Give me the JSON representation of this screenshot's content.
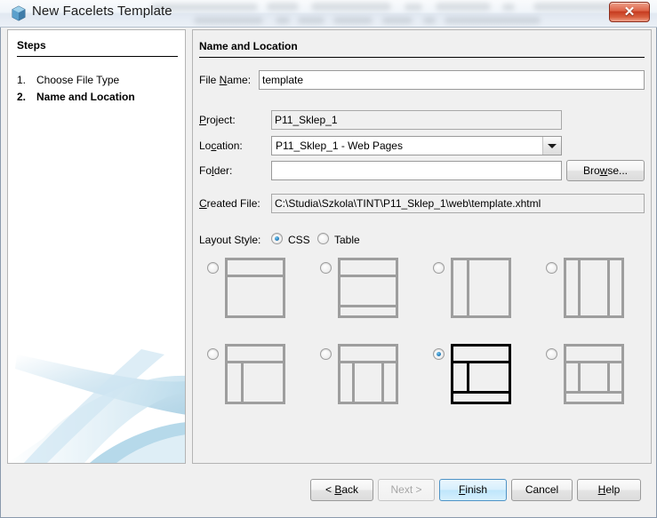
{
  "window": {
    "title": "New Facelets Template",
    "icon": "cube-icon",
    "close_label": "✕"
  },
  "steps": {
    "heading": "Steps",
    "items": [
      {
        "number": "1.",
        "label": "Choose File Type",
        "current": false
      },
      {
        "number": "2.",
        "label": "Name and Location",
        "current": true
      }
    ]
  },
  "content": {
    "heading": "Name and Location",
    "fields": {
      "file_name": {
        "label_pre": "File ",
        "mnemonic": "N",
        "label_post": "ame:",
        "value": "template",
        "placeholder": ""
      },
      "project": {
        "mnemonic": "P",
        "label_post": "roject:",
        "label_pre": "",
        "value": "P11_Sklep_1"
      },
      "location": {
        "label_pre": "Lo",
        "mnemonic": "c",
        "label_post": "ation:",
        "value": "P11_Sklep_1 - Web Pages",
        "options": [
          "P11_Sklep_1 - Web Pages"
        ]
      },
      "folder": {
        "label_pre": "Fo",
        "mnemonic": "l",
        "label_post": "der:",
        "value": "",
        "placeholder": ""
      },
      "created_file": {
        "label_pre": "",
        "mnemonic": "C",
        "label_post": "reated File:",
        "value": "C:\\Studia\\Szkola\\TINT\\P11_Sklep_1\\web\\template.xhtml"
      }
    },
    "browse_button": {
      "label_pre": "Bro",
      "mnemonic": "w",
      "label_post": "se..."
    },
    "layout_style": {
      "label": "Layout Style:",
      "options": [
        {
          "label": "CSS",
          "selected": true
        },
        {
          "label": "Table",
          "selected": false
        }
      ]
    },
    "layout_templates": {
      "selected_index": 6,
      "items": [
        {
          "name": "header-content",
          "selected": false
        },
        {
          "name": "header-content-footer",
          "selected": false
        },
        {
          "name": "sidebar-content",
          "selected": false
        },
        {
          "name": "left-content-right",
          "selected": false
        },
        {
          "name": "header-sidebar-content",
          "selected": false
        },
        {
          "name": "header-three-columns",
          "selected": false
        },
        {
          "name": "header-sidebar-content-footer",
          "selected": true
        },
        {
          "name": "header-three-columns-footer",
          "selected": false
        }
      ]
    }
  },
  "buttons": {
    "back": {
      "label_pre": "< ",
      "mnemonic": "B",
      "label_post": "ack",
      "disabled": false
    },
    "next": {
      "label_pre": "",
      "mnemonic": "N",
      "label_post": "ext >",
      "disabled": true
    },
    "finish": {
      "label_pre": "",
      "mnemonic": "F",
      "label_post": "inish",
      "disabled": false,
      "default": true
    },
    "cancel": {
      "label_pre": "Cancel",
      "mnemonic": "",
      "label_post": "",
      "disabled": false
    },
    "help": {
      "label_pre": "",
      "mnemonic": "H",
      "label_post": "elp",
      "disabled": false
    }
  },
  "colors": {
    "accent": "#2a82bd",
    "close_red": "#c63b20",
    "panel_bg": "#f0f0f0",
    "selected_border": "#000000",
    "thumb_border": "#9e9e9e"
  }
}
